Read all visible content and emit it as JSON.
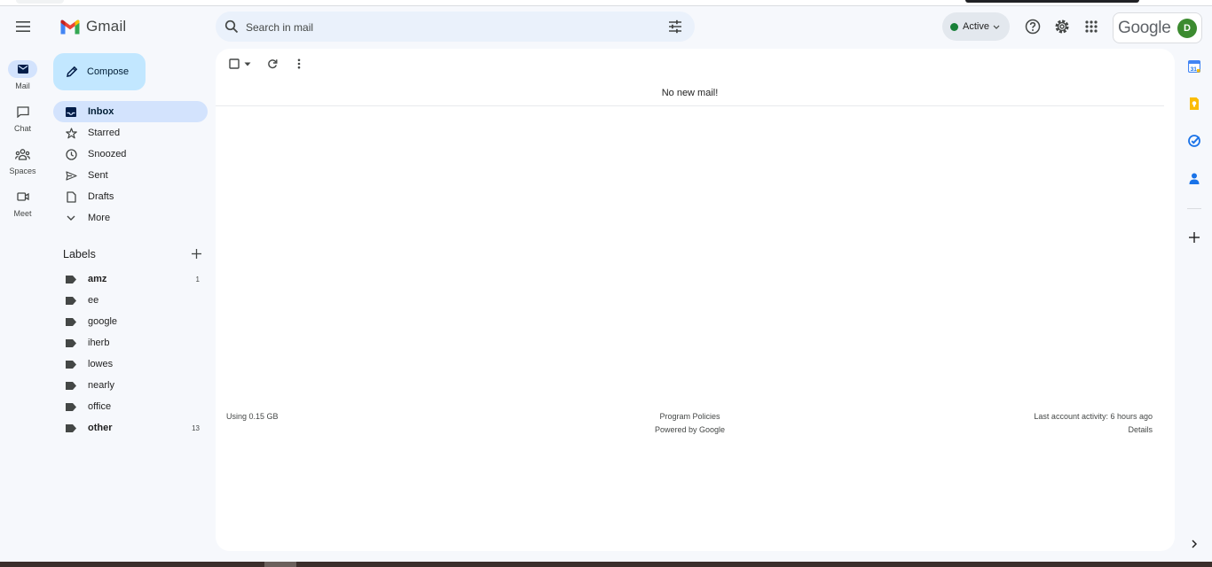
{
  "app": {
    "name": "Gmail"
  },
  "search": {
    "placeholder": "Search in mail"
  },
  "status": {
    "label": "Active",
    "color": "#188038"
  },
  "account": {
    "brand": "Google",
    "avatar_letter": "D",
    "avatar_color": "#3c8b30"
  },
  "rail": [
    {
      "label": "Mail",
      "icon": "mail-icon",
      "active": true
    },
    {
      "label": "Chat",
      "icon": "chat-icon",
      "active": false
    },
    {
      "label": "Spaces",
      "icon": "spaces-icon",
      "active": false
    },
    {
      "label": "Meet",
      "icon": "meet-icon",
      "active": false
    }
  ],
  "compose": {
    "label": "Compose"
  },
  "nav": [
    {
      "label": "Inbox",
      "icon": "inbox-icon",
      "active": true
    },
    {
      "label": "Starred",
      "icon": "star-icon"
    },
    {
      "label": "Snoozed",
      "icon": "clock-icon"
    },
    {
      "label": "Sent",
      "icon": "send-icon"
    },
    {
      "label": "Drafts",
      "icon": "draft-icon"
    },
    {
      "label": "More",
      "icon": "chevron-down-icon"
    }
  ],
  "labels": {
    "title": "Labels",
    "items": [
      {
        "name": "amz",
        "count": "1",
        "bold": true
      },
      {
        "name": "ee",
        "count": ""
      },
      {
        "name": "google",
        "count": ""
      },
      {
        "name": "iherb",
        "count": ""
      },
      {
        "name": "lowes",
        "count": ""
      },
      {
        "name": "nearly",
        "count": ""
      },
      {
        "name": "office",
        "count": ""
      },
      {
        "name": "other",
        "count": "13",
        "bold": true
      }
    ]
  },
  "main": {
    "empty_message": "No new mail!",
    "footer": {
      "storage": "Using 0.15 GB",
      "policies": "Program Policies",
      "powered": "Powered by Google",
      "activity": "Last account activity: 6 hours ago",
      "details": "Details"
    }
  },
  "colors": {
    "accent": "#0b57d0",
    "selected": "#d3e3fd",
    "compose": "#c2e7ff",
    "background": "#f6f8fc"
  }
}
